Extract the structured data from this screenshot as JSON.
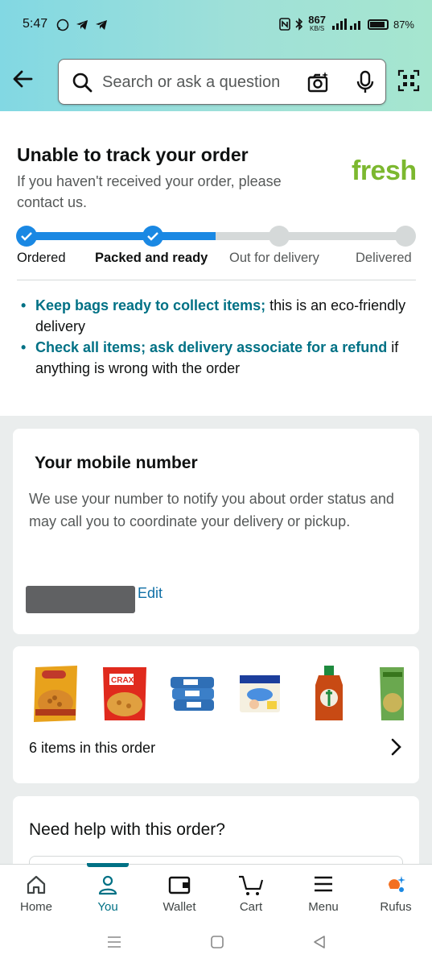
{
  "status_bar": {
    "time": "5:47",
    "left_icons": [
      "whatsapp-icon",
      "telegram-icon",
      "telegram-icon"
    ],
    "net_speed": "867",
    "net_unit": "KB/S",
    "battery": "87%"
  },
  "header": {
    "search_placeholder": "Search or ask a question"
  },
  "tracking": {
    "title": "Unable to track your order",
    "subtitle": "If you haven't received your order, please contact us.",
    "brand": "fresh",
    "progress": 0.5,
    "steps": [
      {
        "label": "Ordered",
        "state": "done"
      },
      {
        "label": "Packed and ready",
        "state": "done"
      },
      {
        "label": "Out for delivery",
        "state": "todo"
      },
      {
        "label": "Delivered",
        "state": "todo"
      }
    ],
    "tips": [
      {
        "highlight": "Keep bags ready to collect items;",
        "rest": " this is an eco-friendly delivery"
      },
      {
        "highlight": "Check all items; ask delivery associate for a refund",
        "rest": " if anything is wrong with the order"
      }
    ]
  },
  "mobile_card": {
    "title": "Your mobile number",
    "body": "We use your number to notify you about order status and may call you to coordinate your delivery or pickup.",
    "edit_label": "Edit"
  },
  "items_card": {
    "summary": "6 items in this order",
    "thumbnails": [
      "namkeen-pack",
      "crax-pack",
      "wipes-pack",
      "diaper-pack",
      "antiseptic-bottle",
      "snack-pack"
    ]
  },
  "help_card": {
    "title": "Need help with this order?"
  },
  "bottom_nav": {
    "items": [
      {
        "label": "Home",
        "icon": "home-icon"
      },
      {
        "label": "You",
        "icon": "user-icon",
        "active": true
      },
      {
        "label": "Wallet",
        "icon": "wallet-icon"
      },
      {
        "label": "Cart",
        "icon": "cart-icon"
      },
      {
        "label": "Menu",
        "icon": "menu-icon"
      },
      {
        "label": "Rufus",
        "icon": "rufus-icon"
      }
    ]
  },
  "colors": {
    "accent": "#007185",
    "progress_blue": "#1a88e3",
    "fresh_green": "#7cb82f",
    "header_gradient_start": "#82d8e3",
    "header_gradient_end": "#a6e6cf"
  }
}
